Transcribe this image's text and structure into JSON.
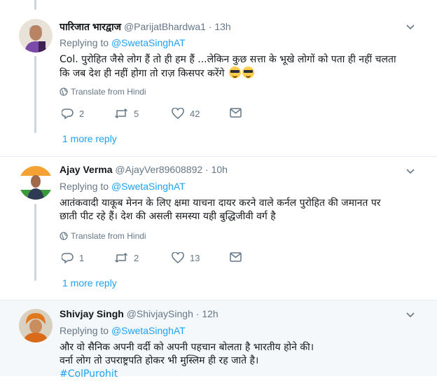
{
  "tweets": [
    {
      "name": "पारिजात भारद्वाज",
      "handle": "@ParijatBhardwa1",
      "time": "13h",
      "replying_label": "Replying to",
      "replying_handle": "@SwetaSinghAT",
      "text_line1": "Col. पुरोहित जैसे लोग हैं तो ही हम हैं ...लेकिन कुछ  सत्ता के भूखे लोगों को पता  ही नहीं चलता",
      "text_line2": "कि जब देश ही नहीं होगा तो राज़ किसपर करेंगे",
      "translate": "Translate from Hindi",
      "replies": "2",
      "retweets": "5",
      "likes": "42",
      "more_replies": "1 more reply"
    },
    {
      "name": "Ajay Verma",
      "handle": "@AjayVer89608892",
      "time": "10h",
      "replying_label": "Replying to",
      "replying_handle": "@SwetaSinghAT",
      "text_line1": "आतंकवादी याकूब मेनन के लिए क्षमा याचना दायर करने वाले कर्नल पुरोहित की जमानत पर",
      "text_line2": "छाती पीट रहे हैं। देश की असली समस्या यही बुद्धिजीवी वर्ग है",
      "translate": "Translate from Hindi",
      "replies": "1",
      "retweets": "2",
      "likes": "13",
      "more_replies": "1 more reply"
    },
    {
      "name": "Shivjay Singh",
      "handle": "@ShivjaySingh",
      "time": "12h",
      "replying_label": "Replying to",
      "replying_handle": "@SwetaSinghAT",
      "text_line1": "और वो सैनिक अपनी वर्दी को अपनी पहचान बोलता है भारतीय होने की।",
      "text_line2": "वर्ना लोग तो उपराष्ट्रपति होकर भी मुस्लिम ही रह जाते है।",
      "hashtag": "#ColPurohit"
    }
  ],
  "separator": "·",
  "icons": {
    "caret": "chevron-down-icon",
    "globe": "globe-icon",
    "reply": "reply-icon",
    "retweet": "retweet-icon",
    "like": "heart-icon",
    "dm": "envelope-icon"
  },
  "colors": {
    "link": "#1da1f2",
    "secondary": "#657786",
    "thread_line": "#ccd6dd",
    "highlight_bg": "#f5f8fa"
  }
}
